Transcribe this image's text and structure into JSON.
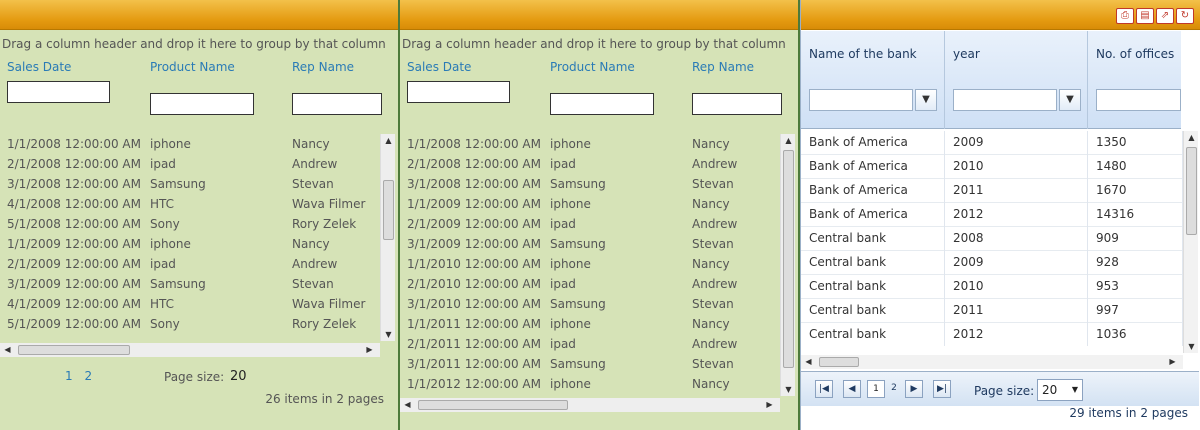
{
  "panel1": {
    "group_hint": "Drag a column header and drop it here to group by that column",
    "columns": [
      "Sales Date",
      "Product Name",
      "Rep Name"
    ],
    "rows": [
      [
        "1/1/2008 12:00:00 AM",
        "iphone",
        "Nancy"
      ],
      [
        "2/1/2008 12:00:00 AM",
        "ipad",
        "Andrew"
      ],
      [
        "3/1/2008 12:00:00 AM",
        "Samsung",
        "Stevan"
      ],
      [
        "4/1/2008 12:00:00 AM",
        "HTC",
        "Wava Filmer"
      ],
      [
        "5/1/2008 12:00:00 AM",
        "Sony",
        "Rory Zelek"
      ],
      [
        "1/1/2009 12:00:00 AM",
        "iphone",
        "Nancy"
      ],
      [
        "2/1/2009 12:00:00 AM",
        "ipad",
        "Andrew"
      ],
      [
        "3/1/2009 12:00:00 AM",
        "Samsung",
        "Stevan"
      ],
      [
        "4/1/2009 12:00:00 AM",
        "HTC",
        "Wava Filmer"
      ],
      [
        "5/1/2009 12:00:00 AM",
        "Sony",
        "Rory Zelek"
      ]
    ],
    "pages": [
      "1",
      "2"
    ],
    "page_size_label": "Page size:",
    "page_size_value": "20",
    "items_info": "26 items in 2 pages"
  },
  "panel2": {
    "group_hint": "Drag a column header and drop it here to group by that column",
    "columns": [
      "Sales Date",
      "Product Name",
      "Rep Name"
    ],
    "rows": [
      [
        "1/1/2008 12:00:00 AM",
        "iphone",
        "Nancy"
      ],
      [
        "2/1/2008 12:00:00 AM",
        "ipad",
        "Andrew"
      ],
      [
        "3/1/2008 12:00:00 AM",
        "Samsung",
        "Stevan"
      ],
      [
        "1/1/2009 12:00:00 AM",
        "iphone",
        "Nancy"
      ],
      [
        "2/1/2009 12:00:00 AM",
        "ipad",
        "Andrew"
      ],
      [
        "3/1/2009 12:00:00 AM",
        "Samsung",
        "Stevan"
      ],
      [
        "1/1/2010 12:00:00 AM",
        "iphone",
        "Nancy"
      ],
      [
        "2/1/2010 12:00:00 AM",
        "ipad",
        "Andrew"
      ],
      [
        "3/1/2010 12:00:00 AM",
        "Samsung",
        "Stevan"
      ],
      [
        "1/1/2011 12:00:00 AM",
        "iphone",
        "Nancy"
      ],
      [
        "2/1/2011 12:00:00 AM",
        "ipad",
        "Andrew"
      ],
      [
        "3/1/2011 12:00:00 AM",
        "Samsung",
        "Stevan"
      ],
      [
        "1/1/2012 12:00:00 AM",
        "iphone",
        "Nancy"
      ]
    ]
  },
  "panel3": {
    "toolbar_icons": [
      "print-icon",
      "database-icon",
      "export-icon",
      "refresh-icon"
    ],
    "columns": [
      "Name of the bank",
      "year",
      "No. of offices"
    ],
    "rows": [
      [
        "Bank of America",
        "2009",
        "1350"
      ],
      [
        "Bank of America",
        "2010",
        "1480"
      ],
      [
        "Bank of America",
        "2011",
        "1670"
      ],
      [
        "Bank of America",
        "2012",
        "14316"
      ],
      [
        "Central bank",
        "2008",
        "909"
      ],
      [
        "Central bank",
        "2009",
        "928"
      ],
      [
        "Central bank",
        "2010",
        "953"
      ],
      [
        "Central bank",
        "2011",
        "997"
      ],
      [
        "Central bank",
        "2012",
        "1036"
      ]
    ],
    "pages": [
      "1",
      "2"
    ],
    "current_page": "1",
    "page_size_label": "Page size:",
    "page_size_value": "20",
    "items_info": "29 items in 2 pages"
  },
  "colors": {
    "header_orange": "#e49a10",
    "panel_green": "#d6e3b7",
    "link_blue": "#2a7bb6",
    "grid_header_blue": "#cfe0f5"
  }
}
